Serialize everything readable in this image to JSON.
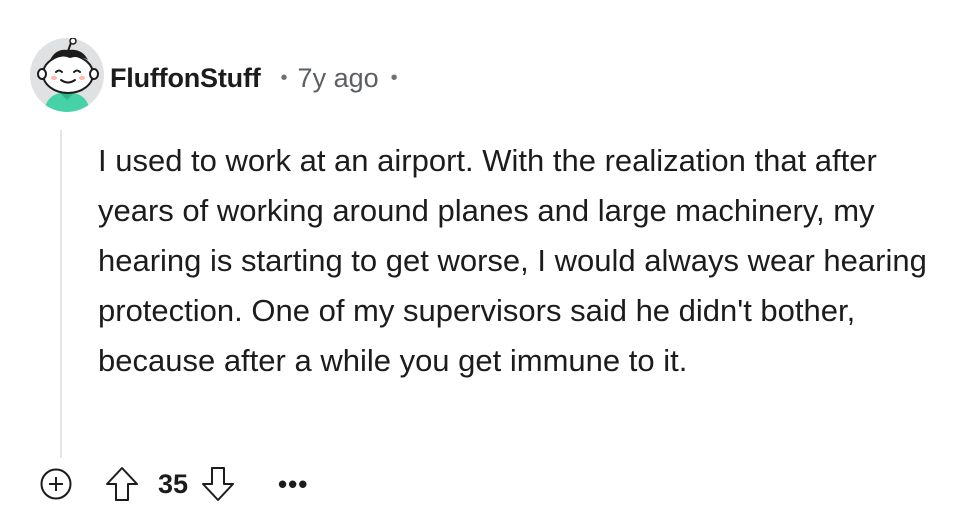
{
  "comment": {
    "username": "FluffonStuff",
    "separator": "•",
    "age": "7y ago",
    "body": "I used to work at an airport. With the realization that after years of working around planes and large machinery, my hearing is starting to get worse, I would always wear hearing protection. One of my supervisors said he didn't bother, because after a while you get immune to it.",
    "score": "35",
    "more_label": "•••"
  },
  "icons": {
    "avatar": "snoo-avatar-icon",
    "expand": "plus-circle-icon",
    "upvote": "arrow-up-icon",
    "downvote": "arrow-down-icon",
    "more": "ellipsis-icon"
  },
  "colors": {
    "text": "#1c1c1c",
    "muted": "#5b5e62",
    "thread_line": "#e5e6e8",
    "avatar_bg": "#dfe1e3",
    "avatar_shirt": "#46d1a6"
  }
}
